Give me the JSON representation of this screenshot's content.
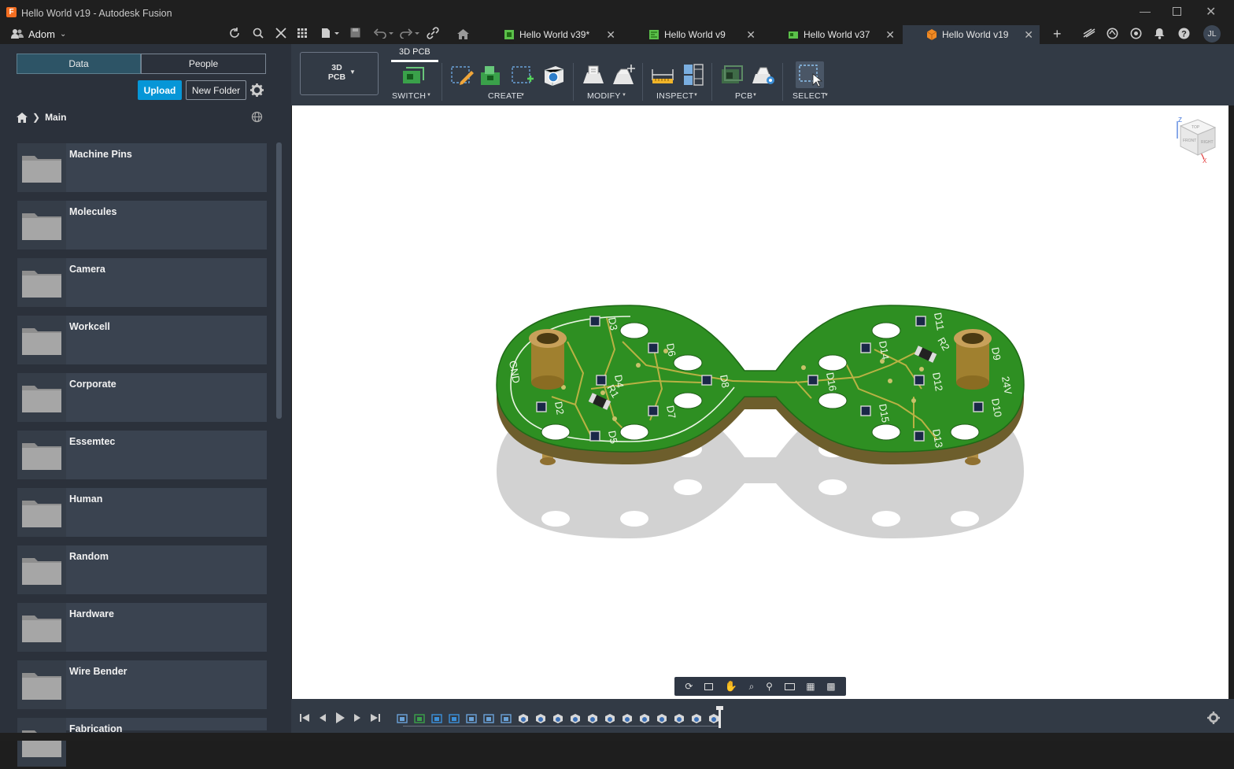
{
  "window": {
    "title": "Hello World v19 - Autodesk Fusion"
  },
  "account": {
    "team": "Adom",
    "avatar_initials": "JL"
  },
  "tabs": [
    {
      "label": "Hello World v39*"
    },
    {
      "label": "Hello World v9"
    },
    {
      "label": "Hello World v37"
    },
    {
      "label": "Hello World v19",
      "active": true
    }
  ],
  "data_panel": {
    "toggle": {
      "data": "Data",
      "people": "People"
    },
    "upload": "Upload",
    "new_folder": "New Folder",
    "breadcrumb": "Main",
    "folders": [
      "Machine Pins",
      "Molecules",
      "Camera",
      "Workcell",
      "Corporate",
      "Essemtec",
      "Human",
      "Random",
      "Hardware",
      "Wire Bender",
      "Fabrication"
    ]
  },
  "ribbon": {
    "workspace": "3D\nPCB",
    "workspace_line1": "3D",
    "workspace_line2": "PCB",
    "active_tab": "3D PCB",
    "groups": {
      "switch": "SWITCH",
      "create": "CREATE",
      "modify": "MODIFY",
      "inspect": "INSPECT",
      "pcb": "PCB",
      "select": "SELECT"
    }
  },
  "viewcube": {
    "top": "TOP",
    "front": "FRONT",
    "right": "RIGHT",
    "axis_z": "Z",
    "axis_x": "X"
  },
  "pcb": {
    "silkscreen": {
      "gnd": "GND",
      "v24": "24V"
    },
    "designators": [
      "D3",
      "D6",
      "D4",
      "D2",
      "R1",
      "D5",
      "D7",
      "D8",
      "D11",
      "D14",
      "R2",
      "D9",
      "D16",
      "D12",
      "D15",
      "D10",
      "D13"
    ]
  },
  "colors": {
    "accent": "#0696d7",
    "pcb_green": "#2e8f22",
    "board_edge": "#8a7a3a"
  }
}
